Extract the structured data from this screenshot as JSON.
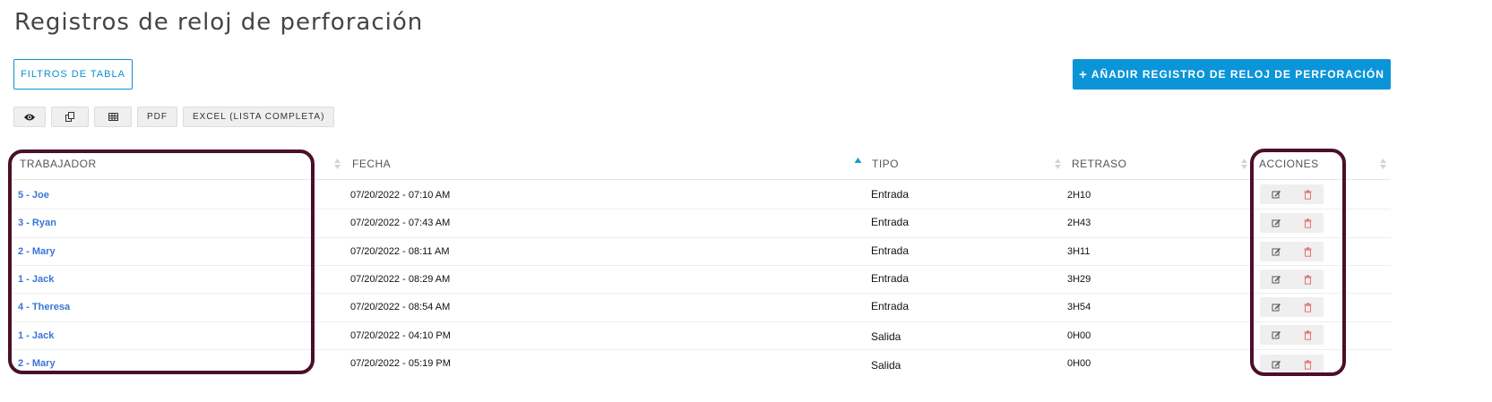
{
  "page": {
    "title": "Registros de reloj de perforación"
  },
  "toolbar": {
    "filters_label": "FILTROS DE TABLA",
    "add_label": "AÑADIR REGISTRO DE RELOJ DE PERFORACIÓN",
    "add_icon": "+",
    "export_buttons": {
      "visibility": "eye-icon",
      "copy": "copy-icon",
      "csv": "table-icon",
      "pdf": "PDF",
      "excel": "EXCEL (LISTA COMPLETA)"
    }
  },
  "table": {
    "columns": [
      "TRABAJADOR",
      "FECHA",
      "TIPO",
      "RETRASO",
      "ACCIONES"
    ],
    "sorted_column": "FECHA",
    "rows": [
      {
        "worker": "5 - Joe",
        "fecha": "07/20/2022 - 07:10 AM",
        "tipo": "Entrada",
        "retraso": "2H10"
      },
      {
        "worker": "3 - Ryan",
        "fecha": "07/20/2022 - 07:43 AM",
        "tipo": "Entrada",
        "retraso": "2H43"
      },
      {
        "worker": "2 - Mary",
        "fecha": "07/20/2022 - 08:11 AM",
        "tipo": "Entrada",
        "retraso": "3H11"
      },
      {
        "worker": "1 - Jack",
        "fecha": "07/20/2022 - 08:29 AM",
        "tipo": "Entrada",
        "retraso": "3H29"
      },
      {
        "worker": "4 - Theresa",
        "fecha": "07/20/2022 - 08:54 AM",
        "tipo": "Entrada",
        "retraso": "3H54"
      },
      {
        "worker": "1 - Jack",
        "fecha": "07/20/2022 - 04:10 PM",
        "tipo": "Salida",
        "retraso": "0H00"
      },
      {
        "worker": "2 - Mary",
        "fecha": "07/20/2022 - 05:19 PM",
        "tipo": "Salida",
        "retraso": "0H00"
      }
    ]
  },
  "colors": {
    "accent": "#0b95d8",
    "link": "#3a75d6",
    "highlight": "#4a0f2a",
    "delete": "#e57373"
  }
}
